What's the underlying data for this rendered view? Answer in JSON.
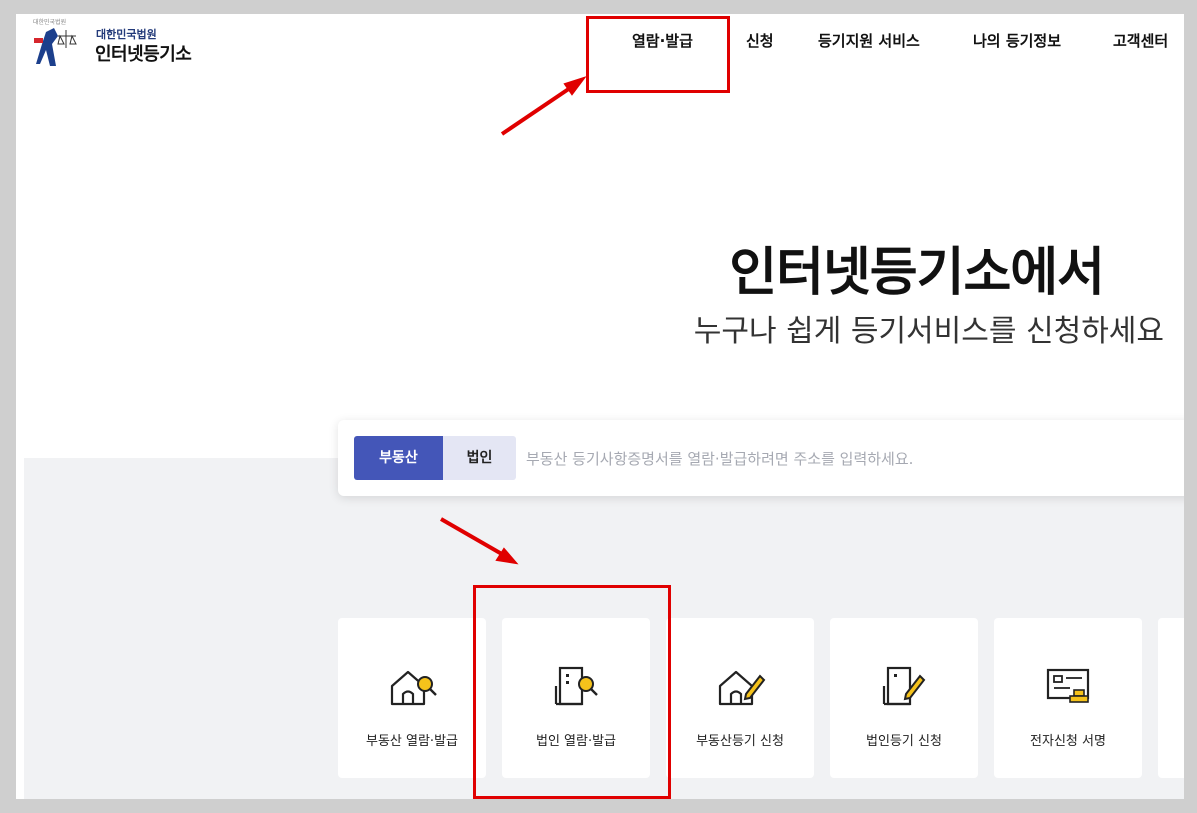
{
  "logo": {
    "emblem_text": "대한민국법원",
    "subtitle": "대한민국법원",
    "title": "인터넷등기소"
  },
  "nav": {
    "items": [
      {
        "label": "열람·발급"
      },
      {
        "label": "신청"
      },
      {
        "label": "등기지원 서비스"
      },
      {
        "label": "나의 등기정보"
      },
      {
        "label": "고객센터"
      }
    ]
  },
  "hero": {
    "title": "인터넷등기소에서",
    "subtitle": "누구나 쉽게 등기서비스를 신청하세요"
  },
  "search": {
    "tabs": [
      "부동산",
      "법인"
    ],
    "active_tab": "부동산",
    "placeholder": "부동산 등기사항증명서를 열람·발급하려면 주소를 입력하세요.",
    "value": ""
  },
  "cards": [
    {
      "label": "부동산 열람·발급",
      "icon": "house-search-icon"
    },
    {
      "label": "법인 열람·발급",
      "icon": "building-search-icon"
    },
    {
      "label": "부동산등기 신청",
      "icon": "house-pen-icon"
    },
    {
      "label": "법인등기 신청",
      "icon": "building-pen-icon"
    },
    {
      "label": "전자신청 서명",
      "icon": "document-stamp-icon"
    }
  ],
  "colors": {
    "accent": "#4456b8",
    "icon_yellow": "#f5c21b",
    "annotation_red": "#e00000"
  }
}
